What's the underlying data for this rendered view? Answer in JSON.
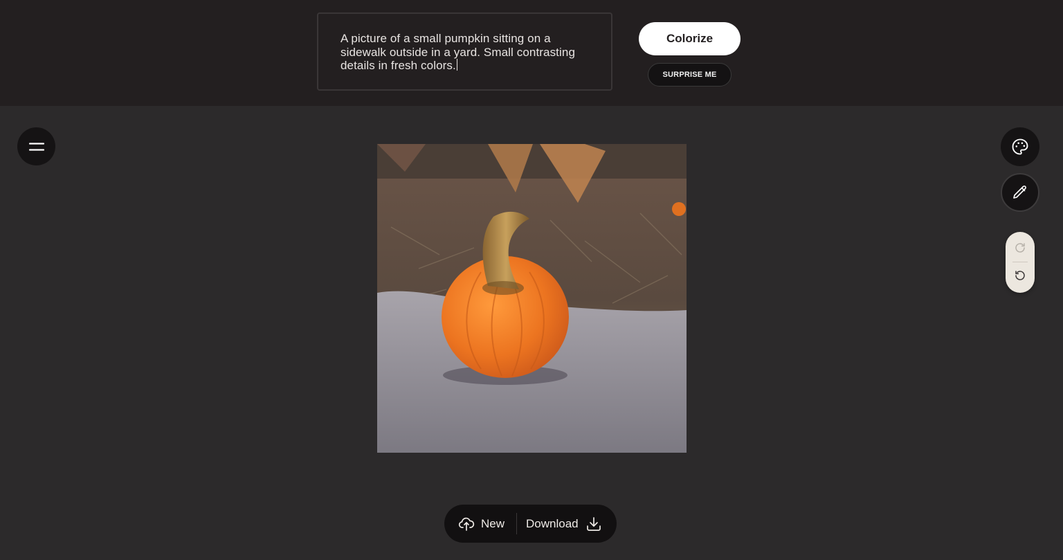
{
  "prompt": {
    "text": "A picture of a small pumpkin sitting on a sidewalk outside in a yard. Small contrasting details in fresh colors."
  },
  "actions": {
    "colorize_label": "Colorize",
    "surprise_label": "SURPRISE ME"
  },
  "toolbar": {
    "new_label": "New",
    "download_label": "Download"
  },
  "icons": {
    "menu": "menu-icon",
    "palette": "palette-icon",
    "pencil": "pencil-icon",
    "redo": "redo-icon",
    "undo": "undo-icon",
    "upload": "upload-cloud-icon",
    "download": "download-icon"
  },
  "colors": {
    "background": "#2c2a2b",
    "topbar": "#231f20",
    "button_light": "#ffffff",
    "button_dark": "#151314",
    "history_pill": "#ece7df",
    "pumpkin": "#e8711c"
  }
}
